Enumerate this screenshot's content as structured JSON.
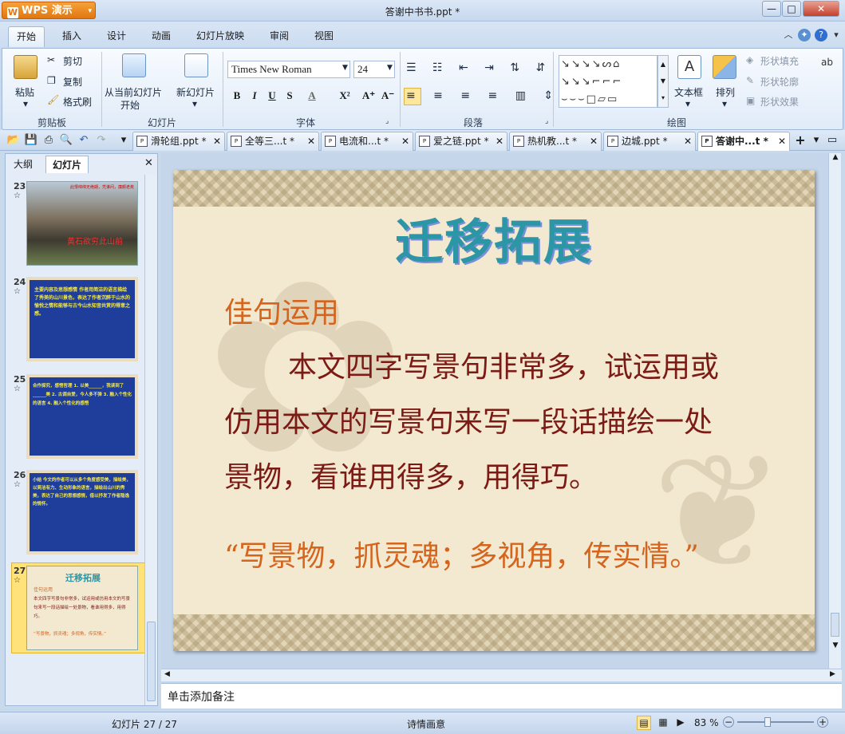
{
  "app": {
    "name": "WPS 演示",
    "window_title": "答谢中书书.ppt *"
  },
  "window_controls": {
    "minimize": "—",
    "maximize": "□",
    "close": "✕"
  },
  "menu_tabs": [
    "开始",
    "插入",
    "设计",
    "动画",
    "幻灯片放映",
    "审阅",
    "视图"
  ],
  "ribbon": {
    "clipboard": {
      "paste": "粘贴",
      "cut": "剪切",
      "copy": "复制",
      "format_painter": "格式刷",
      "label": "剪贴板"
    },
    "slides": {
      "from_current": "从当前幻灯片",
      "from_current2": "开始",
      "new_slide": "新幻灯片",
      "label": "幻灯片"
    },
    "font": {
      "name": "Times New Roman",
      "size": "24",
      "label": "字体",
      "bold": "B",
      "italic": "I",
      "underline": "U",
      "strike": "S",
      "color": "A",
      "superscript": "X²",
      "grow": "A⁺",
      "shrink": "A⁻"
    },
    "paragraph": {
      "label": "段落"
    },
    "drawing": {
      "textbox": "文本框",
      "arrange": "排列",
      "shape_fill": "形状填充",
      "shape_outline": "形状轮廓",
      "shape_effect": "形状效果",
      "label": "绘图"
    }
  },
  "doc_tabs": [
    {
      "label": "滑轮组.ppt *"
    },
    {
      "label": "全等三...t *"
    },
    {
      "label": "电流和...t *"
    },
    {
      "label": "爱之链.ppt *"
    },
    {
      "label": "热机教...t *"
    },
    {
      "label": "边城.ppt *"
    },
    {
      "label": "答谢中...t *"
    }
  ],
  "panel": {
    "tab_outline": "大纲",
    "tab_slides": "幻灯片",
    "close": "✕"
  },
  "thumbnails": [
    {
      "num": "23",
      "star": "☆",
      "text": "此恨绵绵无绝期，凭谁问，廉颇老矣",
      "caption": "黄石欲穷此山前"
    },
    {
      "num": "24",
      "star": "☆",
      "text": "主要内容及思想感情 作者用简洁的语言描绘了秀美的山川景色，表达了作者沉醉于山水的愉悦之情和能够与古今山水知音共赏的得意之感。"
    },
    {
      "num": "25",
      "star": "☆",
      "text": "合作探究，感悟哲理 1. 以美______，我读到了______美 2. 古调自爱，今人多不弹 3. 融入个性化的语言 4. 融入个性化的感悟"
    },
    {
      "num": "26",
      "star": "☆",
      "text": "小结 今文的作者可以从多个角度感受美，描绘美，以简洁有力、生动形象的语言，描绘出山川的秀美，表达了自己的思想感情，借以抒发了作者隐逸的情怀。"
    },
    {
      "num": "27",
      "star": "☆",
      "title": "迁移拓展",
      "sub": "佳句运用",
      "text": "本文四字写景句非常多，试运用或仿用本文的写景句来写一段话描绘一处景物，看谁用得多，用得巧。",
      "quote": "“写景物，抓灵魂；多视角，传实情。”"
    }
  ],
  "slide": {
    "title": "迁移拓展",
    "subtitle": "佳句运用",
    "body_line1": "本文四字写景句非常多，试运用或",
    "body_line2": "仿用本文的写景句来写一段话描绘一处",
    "body_line3": "景物，看谁用得多，用得巧。",
    "quote": "“写景物，抓灵魂；多视角，传实情。”"
  },
  "notes_placeholder": "单击添加备注",
  "status": {
    "slide_pos": "幻灯片 27 / 27",
    "theme": "诗情画意",
    "zoom": "83 %"
  },
  "colors": {
    "title": "#2c95a6",
    "subtitle": "#d5641c",
    "body": "#7c1a15",
    "accent_orange": "#e27611"
  }
}
